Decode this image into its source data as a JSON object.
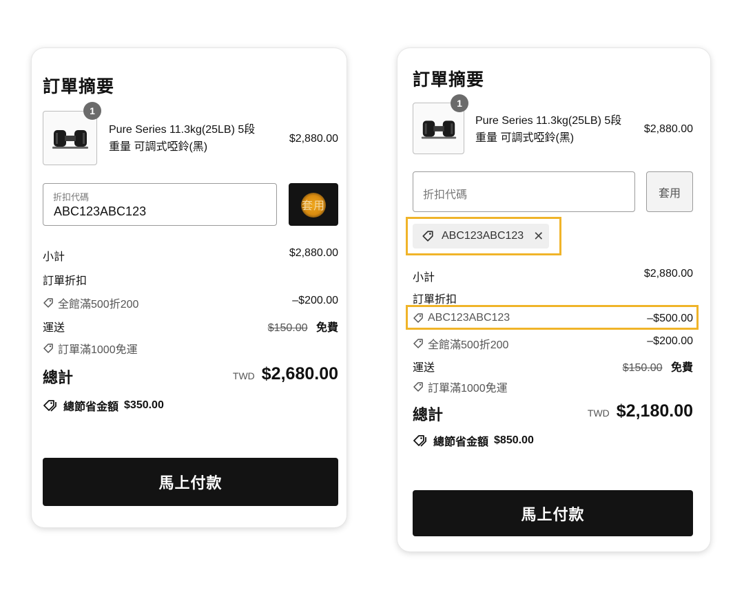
{
  "colors": {
    "highlight": "#f0b429",
    "button_dark": "#131313",
    "apply_glow": "#f0a81e"
  },
  "left": {
    "title": "訂單摘要",
    "item": {
      "qty": "1",
      "name_line1": "Pure Series 11.3kg(25LB) 5段",
      "name_line2": "重量 可調式啞鈴(黑)",
      "price": "$2,880.00",
      "image_icon": "dumbbell-icon"
    },
    "discount_input": {
      "label": "折扣代碼",
      "value": "ABC123ABC123"
    },
    "apply_label": "套用",
    "subtotal_label": "小計",
    "subtotal_value": "$2,880.00",
    "order_discount_label": "訂單折扣",
    "discounts": [
      {
        "name": "全館滿500折200",
        "value": "–$200.00"
      }
    ],
    "shipping_label": "運送",
    "shipping_original": "$150.00",
    "shipping_free": "免費",
    "shipping_promo": "訂單滿1000免運",
    "total_label": "總計",
    "currency": "TWD",
    "total_value": "$2,680.00",
    "savings_label": "總節省金額",
    "savings_value": "$350.00",
    "pay_label": "馬上付款"
  },
  "right": {
    "title": "訂單摘要",
    "item": {
      "qty": "1",
      "name_line1": "Pure Series 11.3kg(25LB) 5段",
      "name_line2": "重量 可調式啞鈴(黑)",
      "price": "$2,880.00",
      "image_icon": "dumbbell-icon"
    },
    "discount_input": {
      "placeholder": "折扣代碼"
    },
    "apply_label": "套用",
    "applied_code": "ABC123ABC123",
    "subtotal_label": "小計",
    "subtotal_value": "$2,880.00",
    "order_discount_label": "訂單折扣",
    "discounts": [
      {
        "name": "ABC123ABC123",
        "value": "–$500.00"
      },
      {
        "name": "全館滿500折200",
        "value": "–$200.00"
      }
    ],
    "shipping_label": "運送",
    "shipping_original": "$150.00",
    "shipping_free": "免費",
    "shipping_promo": "訂單滿1000免運",
    "total_label": "總計",
    "currency": "TWD",
    "total_value": "$2,180.00",
    "savings_label": "總節省金額",
    "savings_value": "$850.00",
    "pay_label": "馬上付款"
  }
}
